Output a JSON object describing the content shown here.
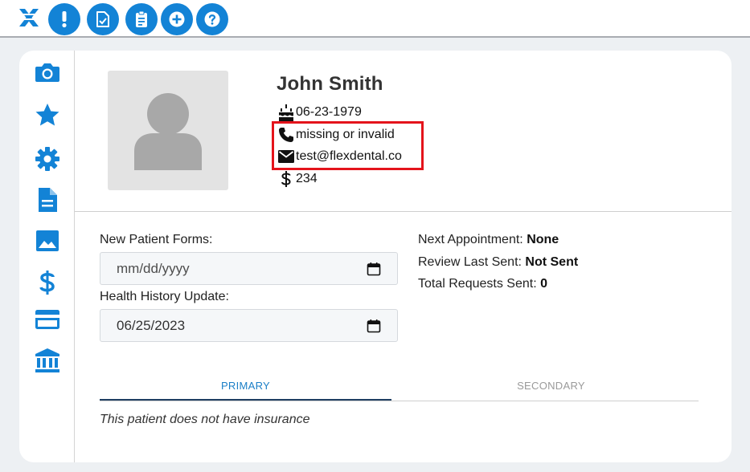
{
  "toolbar": {
    "logo_icon": "flex-x-logo",
    "buttons": [
      {
        "name": "alert",
        "icon": "exclamation-icon"
      },
      {
        "name": "forms",
        "icon": "checked-document-icon"
      },
      {
        "name": "clipboard",
        "icon": "clipboard-icon"
      },
      {
        "name": "add",
        "icon": "plus-icon"
      },
      {
        "name": "help",
        "icon": "question-icon"
      }
    ],
    "accent_color": "#1383d6"
  },
  "sidebar": {
    "icon_color": "#1383d6",
    "items": [
      {
        "name": "camera",
        "icon": "camera-icon"
      },
      {
        "name": "favorites",
        "icon": "star-icon"
      },
      {
        "name": "settings",
        "icon": "gear-icon"
      },
      {
        "name": "documents",
        "icon": "document-icon"
      },
      {
        "name": "images",
        "icon": "image-icon"
      },
      {
        "name": "billing",
        "icon": "dollar-icon"
      },
      {
        "name": "payments",
        "icon": "credit-card-icon"
      },
      {
        "name": "bank",
        "icon": "bank-icon"
      }
    ]
  },
  "patient": {
    "name": "John Smith",
    "birthdate": "06-23-1979",
    "phone": "missing or invalid",
    "email": "test@flexdental.co",
    "balance": "234"
  },
  "forms": {
    "new_patient_label": "New Patient Forms:",
    "new_patient_value": "mm/dd/yyyy",
    "health_history_label": "Health History Update:",
    "health_history_value": "06/25/2023"
  },
  "stats": {
    "next_appointment_label": "Next Appointment:",
    "next_appointment_value": "None",
    "review_label": "Review Last Sent:",
    "review_value": "Not Sent",
    "total_label": "Total Requests Sent:",
    "total_value": "0"
  },
  "insurance": {
    "tabs": [
      "PRIMARY",
      "SECONDARY"
    ],
    "active_tab": "PRIMARY",
    "message": "This patient does not have insurance"
  },
  "highlight_color": "#e4141b"
}
